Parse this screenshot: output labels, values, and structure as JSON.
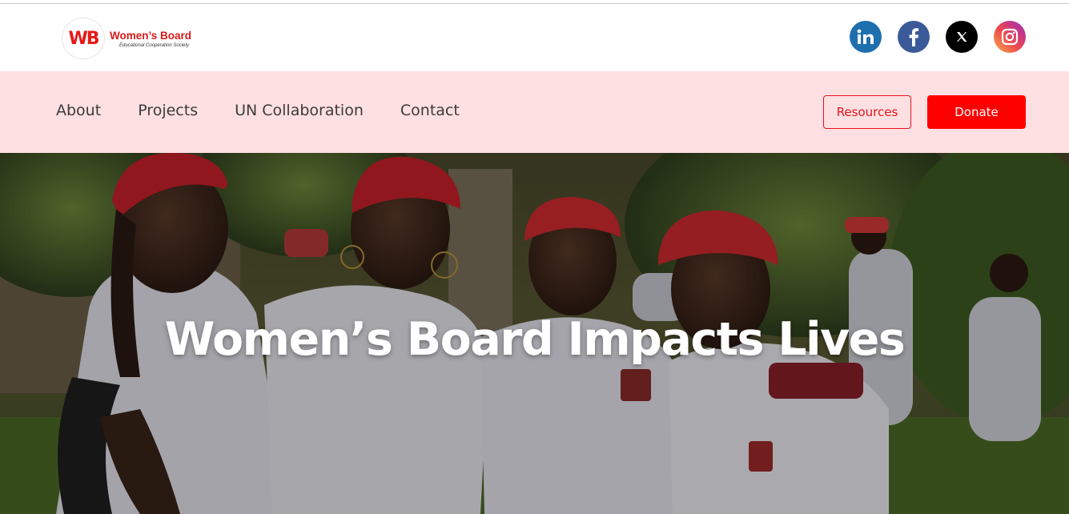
{
  "header": {
    "logo": {
      "mark": "WB",
      "title": "Women’s Board",
      "subtitle": "Educational Cooperation Society"
    },
    "social": [
      {
        "name": "LinkedIn",
        "icon": "linkedin-icon",
        "color": "#1d6fae"
      },
      {
        "name": "Facebook",
        "icon": "facebook-icon",
        "color": "#3b5a9a"
      },
      {
        "name": "X",
        "icon": "x-icon",
        "color": "#000000"
      },
      {
        "name": "Instagram",
        "icon": "instagram-icon",
        "color": "#e1306c"
      }
    ]
  },
  "nav": {
    "links": [
      "About",
      "Projects",
      "UN Collaboration",
      "Contact"
    ],
    "resources_label": "Resources",
    "donate_label": "Donate",
    "background": "#ffe0e2",
    "accent": "#ff0000"
  },
  "hero": {
    "title": "Women’s Board Impacts Lives"
  }
}
